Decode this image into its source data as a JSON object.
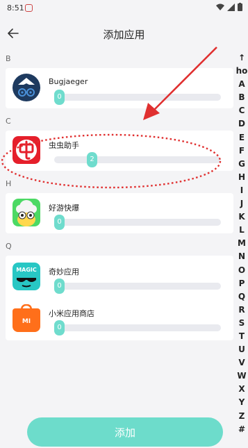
{
  "status_bar": {
    "time": "8:51"
  },
  "header": {
    "title": "添加应用"
  },
  "sections": [
    {
      "letter": "B",
      "apps": [
        {
          "name": "Bugjaeger",
          "level": 0
        }
      ]
    },
    {
      "letter": "C",
      "apps": [
        {
          "name": "虫虫助手",
          "level": 2
        }
      ]
    },
    {
      "letter": "H",
      "apps": [
        {
          "name": "好游快爆",
          "level": 0
        }
      ]
    },
    {
      "letter": "Q",
      "apps": [
        {
          "name": "奇妙应用",
          "level": 0
        },
        {
          "name": "小米应用商店",
          "level": 0
        }
      ]
    }
  ],
  "icons": {
    "bugjaeger": {
      "text": ""
    },
    "magic": {
      "text": "MAGIC"
    },
    "mi": {
      "text": "MI"
    }
  },
  "alpha_index": [
    "↑",
    "ho",
    "A",
    "B",
    "C",
    "D",
    "E",
    "F",
    "G",
    "H",
    "I",
    "J",
    "K",
    "L",
    "M",
    "N",
    "O",
    "P",
    "Q",
    "R",
    "S",
    "T",
    "U",
    "V",
    "W",
    "X",
    "Y",
    "Z",
    "#"
  ],
  "add_button": {
    "label": "添加"
  },
  "colors": {
    "accent": "#6ddccb",
    "annotation": "#e03030"
  }
}
